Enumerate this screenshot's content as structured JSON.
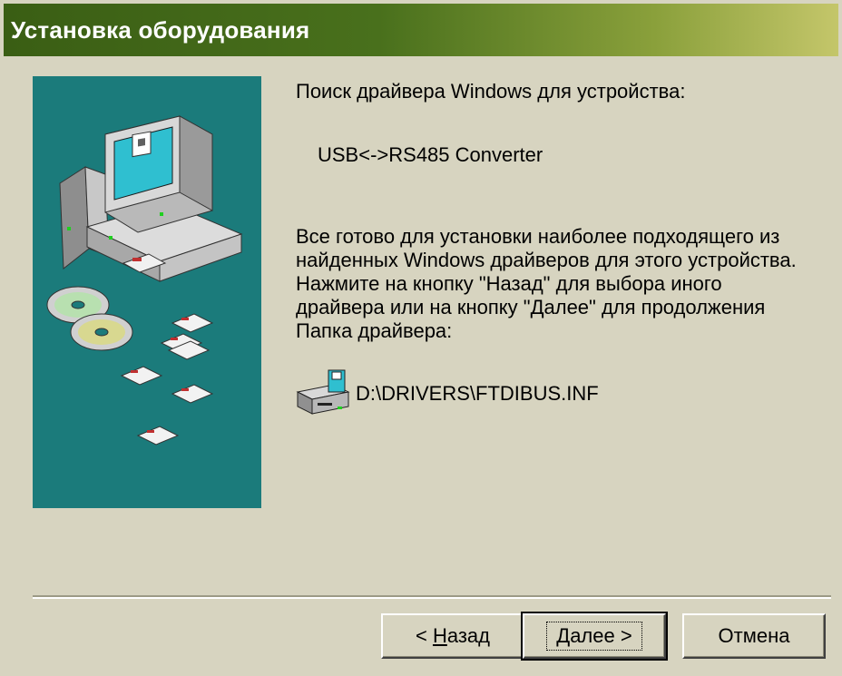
{
  "window": {
    "title": "Установка оборудования"
  },
  "content": {
    "search_label": "Поиск драйвера Windows для устройства:",
    "device_name": "USB<->RS485 Converter",
    "info_lines": [
      "Все готово для установки наиболее подходящего из",
      "найденных Windows драйверов для этого устройства.",
      "Нажмите на кнопку \"Назад\"  для выбора иного",
      "драйвера или на кнопку \"Далее\" для продолжения",
      "Папка драйвера:"
    ],
    "driver_path": "D:\\DRIVERS\\FTDIBUS.INF"
  },
  "buttons": {
    "back_prefix": "< ",
    "back_hotkey": "Н",
    "back_rest": "азад",
    "next_hotkey": "Д",
    "next_rest": "алее >",
    "cancel_label": "Отмена"
  },
  "icons": {
    "art": "computer-cd-floppy-illustration",
    "driver": "floppy-drive-icon"
  },
  "colors": {
    "title_bar": "#3a5e14",
    "dialog_bg": "#d7d4c0",
    "art_bg": "#1b7b7b"
  }
}
